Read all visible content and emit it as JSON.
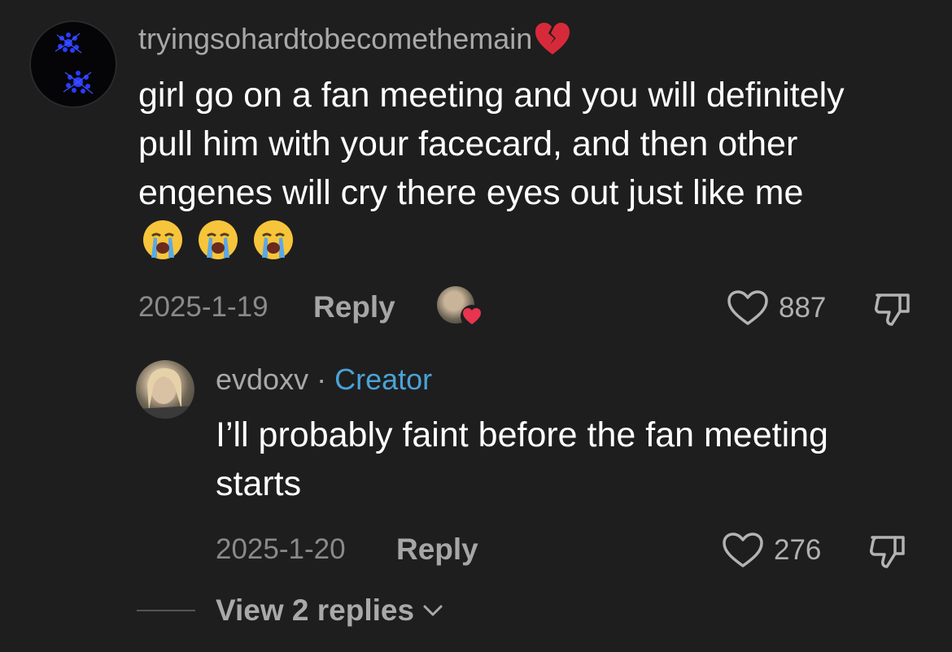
{
  "comment": {
    "username": "tryingsohardtobecomethemain",
    "username_emoji": "broken-heart",
    "text": "girl go on a fan meeting and you will definitely pull him with your facecard, and then other engenes will cry there eyes out just like me",
    "text_emojis": [
      "loudly-crying-face",
      "loudly-crying-face",
      "loudly-crying-face"
    ],
    "date": "2025-1-19",
    "reply_label": "Reply",
    "like_count": "887",
    "creator_liked": true
  },
  "reply": {
    "username": "evdoxv",
    "separator": "·",
    "creator_label": "Creator",
    "text": "I’ll probably faint before the fan meeting starts",
    "date": "2025-1-20",
    "reply_label": "Reply",
    "like_count": "276"
  },
  "view_replies": {
    "label": "View 2 replies"
  },
  "colors": {
    "background": "#1e1e1e",
    "creator_accent": "#4aa2d6",
    "heart_badge": "#e8344e"
  }
}
